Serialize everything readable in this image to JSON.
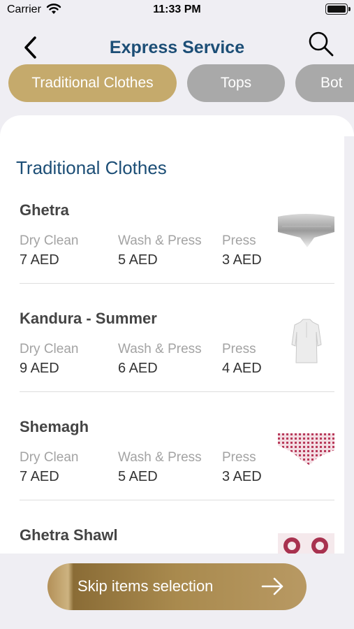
{
  "status_bar": {
    "carrier": "Carrier",
    "time": "11:33 PM"
  },
  "header": {
    "title": "Express Service"
  },
  "categories": [
    {
      "label": "Traditional Clothes",
      "active": true
    },
    {
      "label": "Tops",
      "active": false
    },
    {
      "label": "Bot",
      "active": false
    }
  ],
  "section": {
    "title": "Traditional Clothes"
  },
  "items": [
    {
      "name": "Ghetra",
      "services": [
        {
          "label": "Dry Clean",
          "price": "7 AED"
        },
        {
          "label": "Wash & Press",
          "price": "5 AED"
        },
        {
          "label": "Press",
          "price": "3 AED"
        }
      ]
    },
    {
      "name": "Kandura - Summer",
      "services": [
        {
          "label": "Dry Clean",
          "price": "9 AED"
        },
        {
          "label": "Wash & Press",
          "price": "6 AED"
        },
        {
          "label": "Press",
          "price": "4 AED"
        }
      ]
    },
    {
      "name": "Shemagh",
      "services": [
        {
          "label": "Dry Clean",
          "price": "7 AED"
        },
        {
          "label": "Wash & Press",
          "price": "5 AED"
        },
        {
          "label": "Press",
          "price": "3 AED"
        }
      ]
    },
    {
      "name": "Ghetra Shawl"
    }
  ],
  "footer": {
    "skip_label": "Skip items selection"
  },
  "colors": {
    "brand_gold": "#c5aa6c",
    "title_blue": "#1c4e76",
    "chip_inactive": "#a9a9a9"
  },
  "icons": [
    "back-chevron-icon",
    "search-icon",
    "wifi-icon",
    "battery-icon",
    "arrow-right-icon"
  ]
}
